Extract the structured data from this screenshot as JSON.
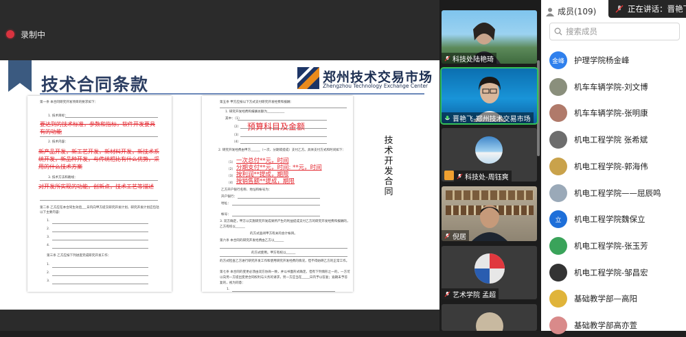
{
  "recording": {
    "label": "录制中"
  },
  "slide": {
    "title": "技术合同条款",
    "logo_cn": "郑州技术交易市场",
    "logo_en": "Zhengzhou Technology Exchange Center",
    "vertical_text": "技术开发合同",
    "left_doc": {
      "heading": "第一条  本合同研究开发项目的要求如下：",
      "item1": "1. 技术目标：",
      "note1": "要达到的技术标准，参数和指标，软件开发要具有的功能",
      "item2": "2. 技术内容：",
      "note2": "新产品开发，新工艺开发，新材料开发，新技术系统开发，新品种开发，与传统相比有什么优势，采用的什么技术方案",
      "item3": "3. 技术方法和路线：",
      "note3": "对开发所实现的功能，创新点，技术工艺等描述",
      "art2": "第二条  乙方应在本合同生效后___日内向甲方提交研究开发计划，研究开发计划应包括以下主要内容：",
      "art3": "第三条  乙方应按下列进度完成研究开发工作："
    },
    "right_doc": {
      "heading": "第五条  甲方应按以下方式支付研究开发经费和报酬：",
      "line1": "1. 研究开发经费和报酬总额为___________",
      "line1b": "其中：（1）",
      "note_budget": "预算科目及金额",
      "line2": "2. 研究开发经费由甲方______（一次、分期或提成）支付乙方。具体支付方式和时间如下：",
      "pay1": "一次总付**元，时间",
      "pay2": "分期支付**元，时间: **元，时间",
      "pay3": "按利润**提成，期限",
      "pay4": "按销售额**提成，期限",
      "bank": "乙方开户银行名称、地址和帐号为：",
      "acct1": "开户银行：",
      "acct2": "地址：",
      "acct3": "帐号：",
      "line3": "3. 双方确定，甲方以实施研究开发成果所产生的利益提成支付乙方的研究开发经费和报酬的，乙方有权以______",
      "line4": "的方式查阅甲方有关的会计帐目。",
      "art6": "第六条  本合同的研究开发经费由乙方以______",
      "art6b": "的方式使用。甲方有权以______",
      "art6c": "的方式检查乙方进行研究开发工作和使用研究开发经费的情况，但不得妨碍乙方的正常工作。",
      "art7": "第七条  本合同的变更必须由双方协商一致，并以书面形式确定。但有下列情形之一的，一方可以向另一方提出变更合同权利与义务的请求，另一方应当在_____日内予以答复；逾期未予答复的，视为同意："
    }
  },
  "videos": [
    {
      "name": "科技处陆艳琦",
      "active": false
    },
    {
      "name": "晋艳飞-郑州技术交易市场",
      "active": true
    },
    {
      "name": "科技处-周钰爽",
      "active": false
    },
    {
      "name": "倪居",
      "active": false
    },
    {
      "name": "艺术学院 孟超",
      "active": false
    }
  ],
  "members_panel": {
    "title": "成员(109)",
    "search_placeholder": "搜索成员",
    "speaking": "正在讲话：晋艳飞",
    "members": [
      {
        "name": "护理学院杨金峰",
        "avatar_text": "金峰",
        "color": "#2f80ed"
      },
      {
        "name": "机车车辆学院-刘文博",
        "avatar_text": "",
        "color": "#8a8f7c"
      },
      {
        "name": "机车车辆学院-张明康",
        "avatar_text": "",
        "color": "#b07a6a"
      },
      {
        "name": "机电工程学院 张希斌",
        "avatar_text": "",
        "color": "#6d6d6d"
      },
      {
        "name": "机电工程学院-郭海伟",
        "avatar_text": "",
        "color": "#c9a24b"
      },
      {
        "name": "机电工程学院——屈辰鸣",
        "avatar_text": "",
        "color": "#9aa9b8"
      },
      {
        "name": "机电工程学院魏保立",
        "avatar_text": "立",
        "color": "#1e6fd9"
      },
      {
        "name": "机电工程学院-张玉芳",
        "avatar_text": "",
        "color": "#3aa35a"
      },
      {
        "name": "机电工程学院-邹昌宏",
        "avatar_text": "",
        "color": "#333333"
      },
      {
        "name": "基础教学部—高阳",
        "avatar_text": "",
        "color": "#e0b43a"
      },
      {
        "name": "基础教学部高亦萱",
        "avatar_text": "",
        "color": "#d98a8a"
      }
    ]
  }
}
